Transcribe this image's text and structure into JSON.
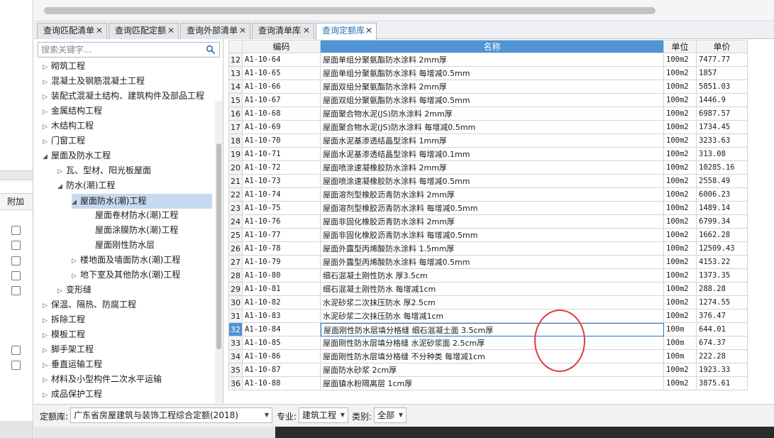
{
  "search": {
    "placeholder": "搜索关键字..."
  },
  "left_strip": {
    "column_header": "附加"
  },
  "tabs": [
    {
      "label": "查询匹配清单",
      "close": "✕"
    },
    {
      "label": "查询匹配定额",
      "close": "✕"
    },
    {
      "label": "查询外部清单",
      "close": "✕"
    },
    {
      "label": "查询清单库",
      "close": "✕"
    },
    {
      "label": "查询定额库",
      "close": "✕"
    }
  ],
  "tree": [
    {
      "label": "砌筑工程",
      "arrow": "▷"
    },
    {
      "label": "混凝土及钢筋混凝土工程",
      "arrow": "▷"
    },
    {
      "label": "装配式混凝土结构、建筑构件及部品工程",
      "arrow": "▷"
    },
    {
      "label": "金属结构工程",
      "arrow": "▷"
    },
    {
      "label": "木结构工程",
      "arrow": "▷"
    },
    {
      "label": "门窗工程",
      "arrow": "▷"
    },
    {
      "label": "屋面及防水工程",
      "arrow": "◢"
    },
    {
      "label": "瓦、型材、阳光板屋面",
      "arrow": "▷"
    },
    {
      "label": "防水(潮)工程",
      "arrow": "◢"
    },
    {
      "label": "屋面防水(潮)工程",
      "arrow": "◢"
    },
    {
      "label": "屋面卷材防水(潮)工程",
      "arrow": ""
    },
    {
      "label": "屋面涂膜防水(潮)工程",
      "arrow": ""
    },
    {
      "label": "屋面刚性防水层",
      "arrow": ""
    },
    {
      "label": "楼地面及墙面防水(潮)工程",
      "arrow": "▷"
    },
    {
      "label": "地下室及其他防水(潮)工程",
      "arrow": "▷"
    },
    {
      "label": "变形缝",
      "arrow": "▷"
    },
    {
      "label": "保温、隔热、防腐工程",
      "arrow": "▷"
    },
    {
      "label": "拆除工程",
      "arrow": "▷"
    },
    {
      "label": "模板工程",
      "arrow": "▷"
    },
    {
      "label": "脚手架工程",
      "arrow": "▷"
    },
    {
      "label": "垂直运输工程",
      "arrow": "▷"
    },
    {
      "label": "材料及小型构件二次水平运输",
      "arrow": "▷"
    },
    {
      "label": "成品保护工程",
      "arrow": "▷"
    }
  ],
  "grid": {
    "headers": {
      "code": "编码",
      "name": "名称",
      "unit": "单位",
      "price": "单价"
    },
    "rows": [
      {
        "idx": "12",
        "code": "A1-10-64",
        "name": "屋面单组分聚氨酯防水涂料 2mm厚",
        "unit": "100m2",
        "price": "7477.77"
      },
      {
        "idx": "13",
        "code": "A1-10-65",
        "name": "屋面单组分聚氨酯防水涂料 每增减0.5mm",
        "unit": "100m2",
        "price": "1857"
      },
      {
        "idx": "14",
        "code": "A1-10-66",
        "name": "屋面双组分聚氨酯防水涂料 2mm厚",
        "unit": "100m2",
        "price": "5851.03"
      },
      {
        "idx": "15",
        "code": "A1-10-67",
        "name": "屋面双组分聚氨酯防水涂料 每增减0.5mm",
        "unit": "100m2",
        "price": "1446.9"
      },
      {
        "idx": "16",
        "code": "A1-10-68",
        "name": "屋面聚合物水泥(JS)防水涂料 2mm厚",
        "unit": "100m2",
        "price": "6987.57"
      },
      {
        "idx": "17",
        "code": "A1-10-69",
        "name": "屋面聚合物水泥(JS)防水涂料 每增减0.5mm",
        "unit": "100m2",
        "price": "1734.45"
      },
      {
        "idx": "18",
        "code": "A1-10-70",
        "name": "屋面水泥基渗透结晶型涂料 1mm厚",
        "unit": "100m2",
        "price": "3233.63"
      },
      {
        "idx": "19",
        "code": "A1-10-71",
        "name": "屋面水泥基渗透结晶型涂料 每增减0.1mm",
        "unit": "100m2",
        "price": "313.08"
      },
      {
        "idx": "20",
        "code": "A1-10-72",
        "name": "屋面喷涂速凝橡胶防水涂料 2mm厚",
        "unit": "100m2",
        "price": "10285.16"
      },
      {
        "idx": "21",
        "code": "A1-10-73",
        "name": "屋面喷涂速凝橡胶防水涂料 每增减0.5mm",
        "unit": "100m2",
        "price": "2558.49"
      },
      {
        "idx": "22",
        "code": "A1-10-74",
        "name": "屋面溶剂型橡胶沥青防水涂料 2mm厚",
        "unit": "100m2",
        "price": "6006.23"
      },
      {
        "idx": "23",
        "code": "A1-10-75",
        "name": "屋面溶剂型橡胶沥青防水涂料 每增减0.5mm",
        "unit": "100m2",
        "price": "1489.14"
      },
      {
        "idx": "24",
        "code": "A1-10-76",
        "name": "屋面非固化橡胶沥青防水涂料 2mm厚",
        "unit": "100m2",
        "price": "6799.34"
      },
      {
        "idx": "25",
        "code": "A1-10-77",
        "name": "屋面非固化橡胶沥青防水涂料 每增减0.5mm",
        "unit": "100m2",
        "price": "1662.28"
      },
      {
        "idx": "26",
        "code": "A1-10-78",
        "name": "屋面外露型丙烯酸防水涂料 1.5mm厚",
        "unit": "100m2",
        "price": "12509.43"
      },
      {
        "idx": "27",
        "code": "A1-10-79",
        "name": "屋面外露型丙烯酸防水涂料 每增减0.5mm",
        "unit": "100m2",
        "price": "4153.22"
      },
      {
        "idx": "28",
        "code": "A1-10-80",
        "name": "细石混凝土刚性防水 厚3.5cm",
        "unit": "100m2",
        "price": "1373.35"
      },
      {
        "idx": "29",
        "code": "A1-10-81",
        "name": "细石混凝土刚性防水 每增减1cm",
        "unit": "100m2",
        "price": "288.28"
      },
      {
        "idx": "30",
        "code": "A1-10-82",
        "name": "水泥砂浆二次抹压防水 厚2.5cm",
        "unit": "100m2",
        "price": "1274.55"
      },
      {
        "idx": "31",
        "code": "A1-10-83",
        "name": "水泥砂浆二次抹压防水 每增减1cm",
        "unit": "100m2",
        "price": "376.47"
      },
      {
        "idx": "32",
        "code": "A1-10-84",
        "name": "屋面刚性防水层填分格缝 细石混凝土面 3.5cm厚",
        "unit": "100m",
        "price": "644.01"
      },
      {
        "idx": "33",
        "code": "A1-10-85",
        "name": "屋面刚性防水层填分格缝 水泥砂浆面 2.5cm厚",
        "unit": "100m",
        "price": "674.37"
      },
      {
        "idx": "34",
        "code": "A1-10-86",
        "name": "屋面刚性防水层填分格缝 不分种类 每增减1cm",
        "unit": "100m",
        "price": "222.28"
      },
      {
        "idx": "35",
        "code": "A1-10-87",
        "name": "屋面防水砂浆 2cm厚",
        "unit": "100m2",
        "price": "1923.33"
      },
      {
        "idx": "36",
        "code": "A1-10-88",
        "name": "屋面镇水粉隔离层 1cm厚",
        "unit": "100m2",
        "price": "3875.61"
      }
    ],
    "selected_idx": "32"
  },
  "bottom": {
    "quota_label": "定额库:",
    "quota_value": "广东省房屋建筑与装饰工程综合定额(2018)",
    "major_label": "专业:",
    "major_value": "建筑工程",
    "category_label": "类别:",
    "category_value": "全部"
  },
  "colors": {
    "accent": "#4f94d6",
    "selection": "#c7d9ef",
    "annotation": "#e23a3a"
  },
  "icons": {
    "search": "search-icon",
    "dropdown": "chevron-down-icon",
    "tree_toggle": "tree-arrow-icon"
  }
}
